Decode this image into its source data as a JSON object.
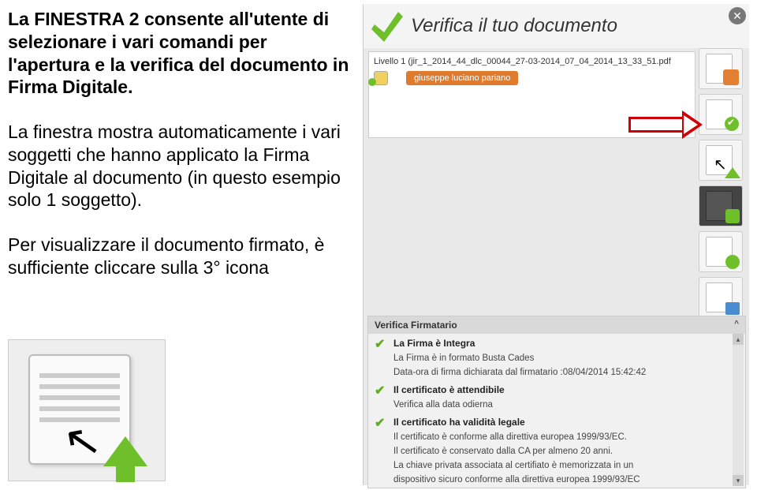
{
  "left": {
    "p1": "La FINESTRA 2 consente all'utente di selezionare i vari comandi per l'apertura e la verifica del documento in Firma Digitale.",
    "p2": "La finestra mostra automaticamente i vari soggetti che hanno applicato la Firma Digitale al documento (in questo esempio solo 1 soggetto).",
    "p3": "Per visualizzare il documento firmato, è sufficiente cliccare sulla 3° icona"
  },
  "app": {
    "title": "Verifica il tuo documento",
    "close": "✕"
  },
  "tree": {
    "level1": "Livello 1 (jir_1_2014_44_dlc_00044_27-03-2014_07_04_2014_13_33_51.pdf",
    "signer": "giuseppe luciano pariano"
  },
  "panel": {
    "header": "Verifica Firmatario",
    "caret": "^",
    "r1_title": "La Firma è Integra",
    "r1_sub1": "La Firma è in formato Busta Cades",
    "r1_sub2": "Data-ora di firma dichiarata dal firmatario :08/04/2014 15:42:42",
    "r2_title": "Il certificato è attendibile",
    "r2_sub1": "Verifica alla data odierna",
    "r3_title": "Il certificato ha validità legale",
    "r3_sub1": "Il certificato è conforme alla direttiva europea 1999/93/EC.",
    "r3_sub2": "Il certificato è conservato dalla CA per almeno 20 anni.",
    "r3_sub3": "La chiave privata associata al certifiato è memorizzata in un",
    "r3_sub4": "dispositivo sicuro conforme alla direttiva europea 1999/93/EC"
  }
}
